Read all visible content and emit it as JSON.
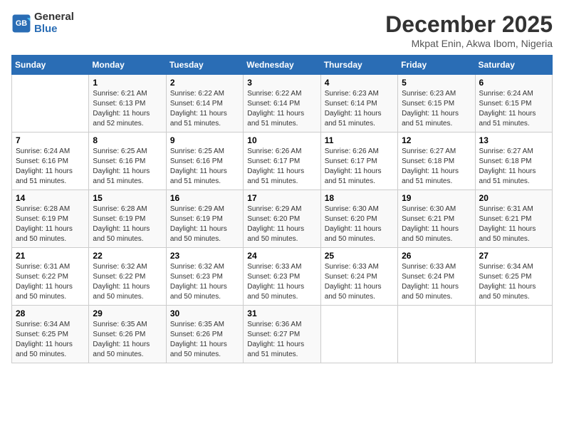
{
  "logo": {
    "line1": "General",
    "line2": "Blue"
  },
  "title": "December 2025",
  "subtitle": "Mkpat Enin, Akwa Ibom, Nigeria",
  "days_of_week": [
    "Sunday",
    "Monday",
    "Tuesday",
    "Wednesday",
    "Thursday",
    "Friday",
    "Saturday"
  ],
  "weeks": [
    [
      {
        "day": "",
        "info": ""
      },
      {
        "day": "1",
        "info": "Sunrise: 6:21 AM\nSunset: 6:13 PM\nDaylight: 11 hours\nand 52 minutes."
      },
      {
        "day": "2",
        "info": "Sunrise: 6:22 AM\nSunset: 6:14 PM\nDaylight: 11 hours\nand 51 minutes."
      },
      {
        "day": "3",
        "info": "Sunrise: 6:22 AM\nSunset: 6:14 PM\nDaylight: 11 hours\nand 51 minutes."
      },
      {
        "day": "4",
        "info": "Sunrise: 6:23 AM\nSunset: 6:14 PM\nDaylight: 11 hours\nand 51 minutes."
      },
      {
        "day": "5",
        "info": "Sunrise: 6:23 AM\nSunset: 6:15 PM\nDaylight: 11 hours\nand 51 minutes."
      },
      {
        "day": "6",
        "info": "Sunrise: 6:24 AM\nSunset: 6:15 PM\nDaylight: 11 hours\nand 51 minutes."
      }
    ],
    [
      {
        "day": "7",
        "info": "Sunrise: 6:24 AM\nSunset: 6:16 PM\nDaylight: 11 hours\nand 51 minutes."
      },
      {
        "day": "8",
        "info": "Sunrise: 6:25 AM\nSunset: 6:16 PM\nDaylight: 11 hours\nand 51 minutes."
      },
      {
        "day": "9",
        "info": "Sunrise: 6:25 AM\nSunset: 6:16 PM\nDaylight: 11 hours\nand 51 minutes."
      },
      {
        "day": "10",
        "info": "Sunrise: 6:26 AM\nSunset: 6:17 PM\nDaylight: 11 hours\nand 51 minutes."
      },
      {
        "day": "11",
        "info": "Sunrise: 6:26 AM\nSunset: 6:17 PM\nDaylight: 11 hours\nand 51 minutes."
      },
      {
        "day": "12",
        "info": "Sunrise: 6:27 AM\nSunset: 6:18 PM\nDaylight: 11 hours\nand 51 minutes."
      },
      {
        "day": "13",
        "info": "Sunrise: 6:27 AM\nSunset: 6:18 PM\nDaylight: 11 hours\nand 51 minutes."
      }
    ],
    [
      {
        "day": "14",
        "info": "Sunrise: 6:28 AM\nSunset: 6:19 PM\nDaylight: 11 hours\nand 50 minutes."
      },
      {
        "day": "15",
        "info": "Sunrise: 6:28 AM\nSunset: 6:19 PM\nDaylight: 11 hours\nand 50 minutes."
      },
      {
        "day": "16",
        "info": "Sunrise: 6:29 AM\nSunset: 6:19 PM\nDaylight: 11 hours\nand 50 minutes."
      },
      {
        "day": "17",
        "info": "Sunrise: 6:29 AM\nSunset: 6:20 PM\nDaylight: 11 hours\nand 50 minutes."
      },
      {
        "day": "18",
        "info": "Sunrise: 6:30 AM\nSunset: 6:20 PM\nDaylight: 11 hours\nand 50 minutes."
      },
      {
        "day": "19",
        "info": "Sunrise: 6:30 AM\nSunset: 6:21 PM\nDaylight: 11 hours\nand 50 minutes."
      },
      {
        "day": "20",
        "info": "Sunrise: 6:31 AM\nSunset: 6:21 PM\nDaylight: 11 hours\nand 50 minutes."
      }
    ],
    [
      {
        "day": "21",
        "info": "Sunrise: 6:31 AM\nSunset: 6:22 PM\nDaylight: 11 hours\nand 50 minutes."
      },
      {
        "day": "22",
        "info": "Sunrise: 6:32 AM\nSunset: 6:22 PM\nDaylight: 11 hours\nand 50 minutes."
      },
      {
        "day": "23",
        "info": "Sunrise: 6:32 AM\nSunset: 6:23 PM\nDaylight: 11 hours\nand 50 minutes."
      },
      {
        "day": "24",
        "info": "Sunrise: 6:33 AM\nSunset: 6:23 PM\nDaylight: 11 hours\nand 50 minutes."
      },
      {
        "day": "25",
        "info": "Sunrise: 6:33 AM\nSunset: 6:24 PM\nDaylight: 11 hours\nand 50 minutes."
      },
      {
        "day": "26",
        "info": "Sunrise: 6:33 AM\nSunset: 6:24 PM\nDaylight: 11 hours\nand 50 minutes."
      },
      {
        "day": "27",
        "info": "Sunrise: 6:34 AM\nSunset: 6:25 PM\nDaylight: 11 hours\nand 50 minutes."
      }
    ],
    [
      {
        "day": "28",
        "info": "Sunrise: 6:34 AM\nSunset: 6:25 PM\nDaylight: 11 hours\nand 50 minutes."
      },
      {
        "day": "29",
        "info": "Sunrise: 6:35 AM\nSunset: 6:26 PM\nDaylight: 11 hours\nand 50 minutes."
      },
      {
        "day": "30",
        "info": "Sunrise: 6:35 AM\nSunset: 6:26 PM\nDaylight: 11 hours\nand 50 minutes."
      },
      {
        "day": "31",
        "info": "Sunrise: 6:36 AM\nSunset: 6:27 PM\nDaylight: 11 hours\nand 51 minutes."
      },
      {
        "day": "",
        "info": ""
      },
      {
        "day": "",
        "info": ""
      },
      {
        "day": "",
        "info": ""
      }
    ]
  ]
}
